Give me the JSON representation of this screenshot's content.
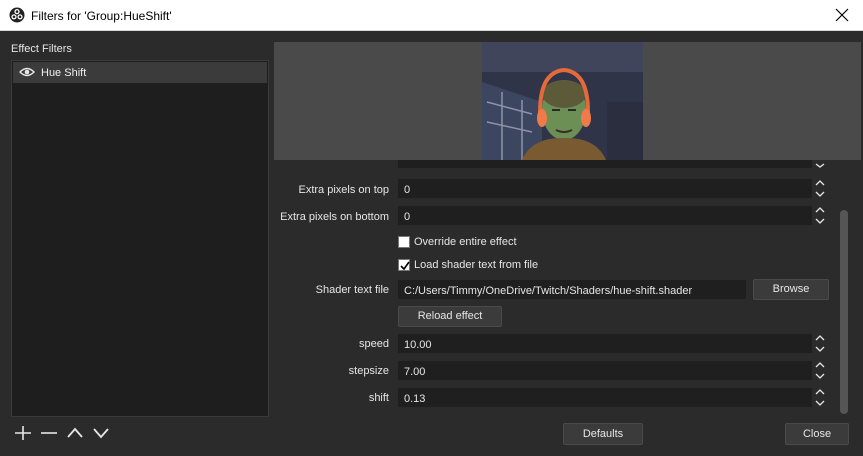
{
  "window": {
    "title": "Filters for 'Group:HueShift'"
  },
  "left_panel": {
    "heading": "Effect Filters",
    "filters": [
      {
        "name": "Hue Shift",
        "visible_icon": "eye-icon"
      }
    ],
    "controls": [
      "plus-icon",
      "minus-icon",
      "chevron-up-icon",
      "chevron-down-icon"
    ]
  },
  "properties": {
    "extra_top": {
      "label": "Extra pixels on top",
      "value": "0"
    },
    "extra_bottom": {
      "label": "Extra pixels on bottom",
      "value": "0"
    },
    "override": {
      "label": "Override entire effect",
      "checked": false
    },
    "load_shader": {
      "label": "Load shader text from file",
      "checked": true
    },
    "shader_file": {
      "label": "Shader text file",
      "value": "C:/Users/Timmy/OneDrive/Twitch/Shaders/hue-shift.shader",
      "browse_label": "Browse"
    },
    "reload_label": "Reload effect",
    "speed": {
      "label": "speed",
      "value": "10.00"
    },
    "stepsize": {
      "label": "stepsize",
      "value": "7.00"
    },
    "shift": {
      "label": "shift",
      "value": "0.13"
    }
  },
  "footer": {
    "defaults_label": "Defaults",
    "close_label": "Close"
  }
}
